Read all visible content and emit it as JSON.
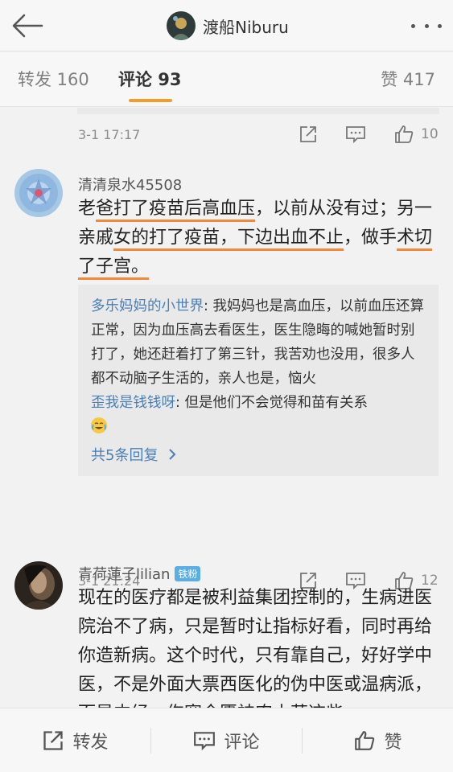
{
  "header": {
    "title": "渡船Niburu",
    "back_icon": "arrow-left-icon",
    "more_icon": "more-dots-icon"
  },
  "tabs": {
    "repost": "转发 160",
    "comment": "评论 93",
    "like": "赞 417"
  },
  "comments": [
    {
      "time": "3-1 17:17",
      "like_count": "10"
    },
    {
      "username": "清清泉水45508",
      "body": {
        "line1_pre": "老",
        "line1_u": "爸打了疫苗后高血压",
        "line1_post": "，以前从没有过；另一亲戚",
        "line2_u": "女的打了疫苗，下边出血不止",
        "line2_post": "，做手",
        "line3_u": "术切了子宫。"
      },
      "replies": [
        {
          "name": "多乐妈妈的小世界",
          "text": ": 我妈妈也是高血压，以前血压还算正常，因为血压高去看医生，医生隐晦的喊她暂时别打了，她还赶着打了第三针，我苦劝也没用，很多人都不动脑子生活的，亲人也是，恼火"
        },
        {
          "name": "歪我是钱钱呀",
          "text": ": 但是他们不会觉得和苗有关系"
        }
      ],
      "more_replies": "共5条回复",
      "time": "3-1 21:24",
      "like_count": "12"
    },
    {
      "username": "青荷蓮子lilian",
      "badge": "铁粉",
      "body": "现在的医疗都是被利益集团控制的，生病进医院治不了病，只是暂时让指标好看，同时再给你造新病。这个时代，只有靠自己，好好学中医，不是外面大票西医化的伪中医或温病派，而是内经，伤寒金匮神农本草这些"
    }
  ],
  "bottom_bar": {
    "repost": "转发",
    "comment": "评论",
    "like": "赞"
  },
  "colors": {
    "accent": "#f59b2c",
    "underline": "#f0893a",
    "link": "#4a7fb5",
    "badge": "#5aaee6"
  }
}
